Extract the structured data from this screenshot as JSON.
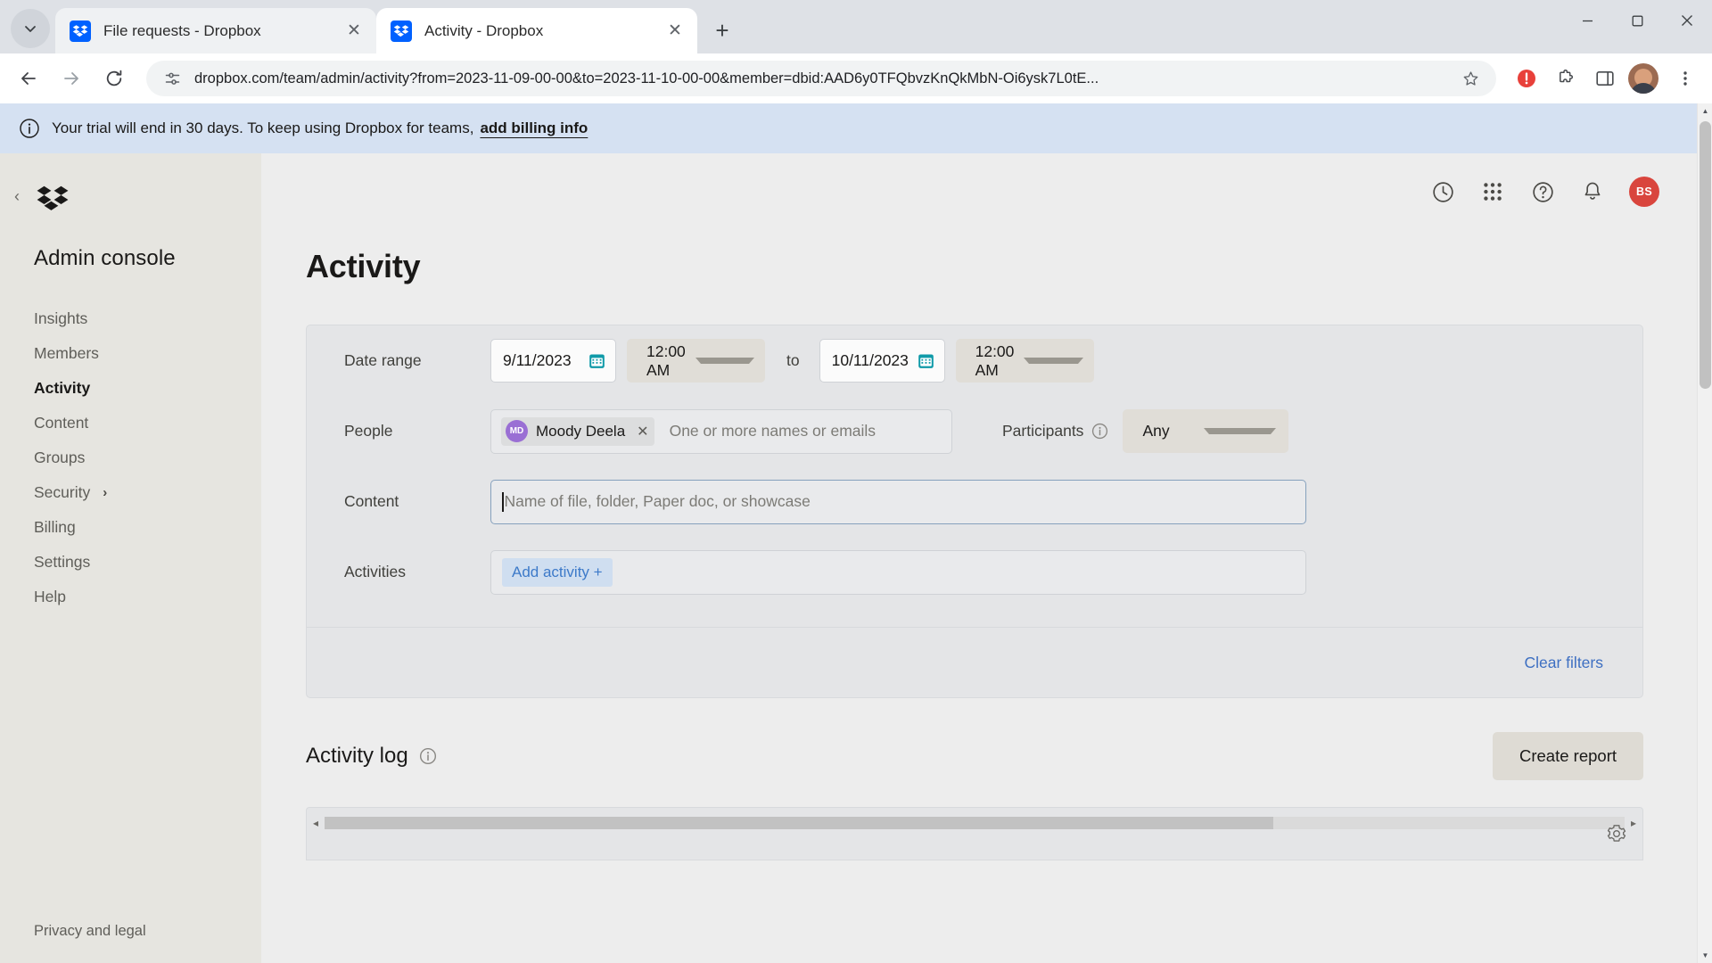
{
  "browser": {
    "tabs": [
      {
        "title": "File requests - Dropbox",
        "active": false,
        "favicon": "dropbox-icon"
      },
      {
        "title": "Activity - Dropbox",
        "active": true,
        "favicon": "dropbox-icon"
      }
    ],
    "new_tab_label": "+",
    "tab_search_icon": "chevron-down-icon",
    "window_controls": {
      "minimize": "–",
      "maximize": "□",
      "close": "✕"
    },
    "nav": {
      "back": "back-arrow-icon",
      "forward": "forward-arrow-icon",
      "reload": "reload-icon"
    },
    "omnibox": {
      "site_info_icon": "site-settings-icon",
      "url": "dropbox.com/team/admin/activity?from=2023-11-09-00-00&to=2023-11-10-00-00&member=dbid:AAD6y0TFQbvzKnQkMbN-Oi6ysk7L0tE...",
      "bookmark_icon": "star-icon"
    },
    "toolbar_icons": [
      "shield-icon",
      "extensions-icon",
      "side-panel-icon",
      "profile-avatar",
      "menu-icon"
    ]
  },
  "banner": {
    "icon": "info-icon",
    "text": "Your trial will end in 30 days. To keep using Dropbox for teams,",
    "link": "add billing info"
  },
  "sidebar": {
    "collapse_icon": "chevron-left-icon",
    "logo": "dropbox-logo",
    "title": "Admin console",
    "items": [
      {
        "label": "Insights",
        "active": false,
        "chevron": false
      },
      {
        "label": "Members",
        "active": false,
        "chevron": false
      },
      {
        "label": "Activity",
        "active": true,
        "chevron": false
      },
      {
        "label": "Content",
        "active": false,
        "chevron": false
      },
      {
        "label": "Groups",
        "active": false,
        "chevron": false
      },
      {
        "label": "Security",
        "active": false,
        "chevron": true,
        "chevron_glyph": "›"
      },
      {
        "label": "Billing",
        "active": false,
        "chevron": false
      },
      {
        "label": "Settings",
        "active": false,
        "chevron": false
      },
      {
        "label": "Help",
        "active": false,
        "chevron": false
      }
    ],
    "legal": "Privacy and legal"
  },
  "header": {
    "icons": [
      "history-icon",
      "apps-grid-icon",
      "help-icon",
      "notifications-bell-icon"
    ],
    "avatar_initials": "BS",
    "avatar_color": "#d9453d"
  },
  "main": {
    "page_title": "Activity",
    "filters": {
      "date_range": {
        "label": "Date range",
        "start_date": "9/11/2023",
        "start_time": "12:00 AM",
        "separator": "to",
        "end_date": "10/11/2023",
        "end_time": "12:00 AM"
      },
      "people": {
        "label": "People",
        "chips": [
          {
            "initials": "MD",
            "name": "Moody Deela",
            "remove": "✕",
            "avatar_color": "#9a6fd4"
          }
        ],
        "placeholder": "One or more names or emails"
      },
      "participants": {
        "label": "Participants",
        "info_icon": "info-icon",
        "value": "Any"
      },
      "content": {
        "label": "Content",
        "placeholder": "Name of file, folder, Paper doc, or showcase",
        "value": "",
        "focused": true
      },
      "activities": {
        "label": "Activities",
        "add_button": "Add activity +"
      },
      "clear_filters": "Clear filters"
    },
    "activity_log": {
      "title": "Activity log",
      "info_icon": "info-icon",
      "create_report": "Create report",
      "settings_icon": "gear-icon",
      "scroll_left": "◂",
      "scroll_right": "▸"
    }
  },
  "colors": {
    "accent_blue": "#0061ff",
    "link_blue": "#3d6fc2",
    "banner_bg": "#d5e1f2",
    "sidebar_bg": "#e6e5e0",
    "avatar_red": "#d9453d",
    "chip_purple": "#9a6fd4"
  }
}
